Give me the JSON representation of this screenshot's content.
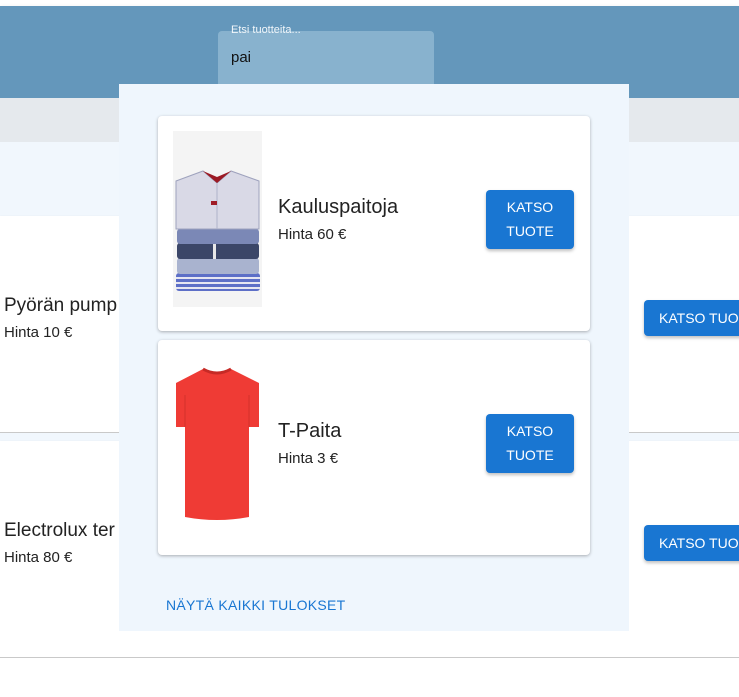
{
  "search": {
    "label": "Etsi tuotteita...",
    "value": "pai"
  },
  "background_products": [
    {
      "name": "Pyörän pump",
      "price": "Hinta 10 €",
      "button": "KATSO TUO"
    },
    {
      "name": "Electrolux ter",
      "price": "Hinta 80 €",
      "button": "KATSO TUO"
    }
  ],
  "results": [
    {
      "name": "Kauluspaitoja",
      "price": "Hinta 60 €",
      "button": "KATSO TUOTE",
      "image_icon": "folded-shirts-image"
    },
    {
      "name": "T-Paita",
      "price": "Hinta 3 €",
      "button": "KATSO TUOTE",
      "image_icon": "red-tshirt-image"
    }
  ],
  "show_all_label": "NÄYTÄ KAIKKI TULOKSET",
  "colors": {
    "appbar": "#6497bb",
    "primary": "#1976d2",
    "dropdown_bg": "#eff6fd"
  }
}
